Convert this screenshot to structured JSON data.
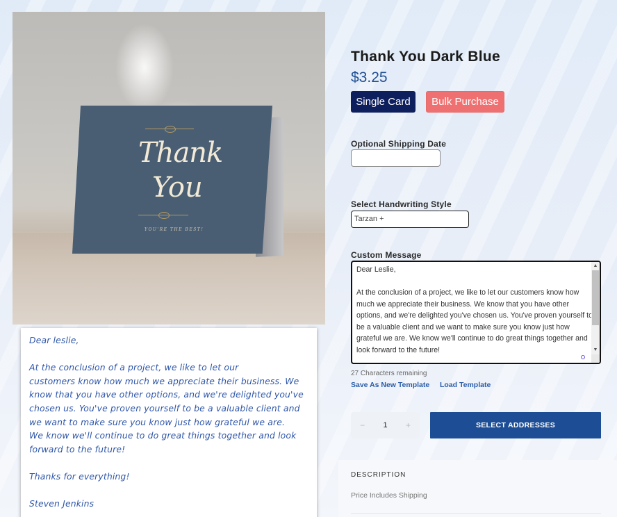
{
  "product": {
    "title": "Thank You Dark Blue",
    "price": "$3.25",
    "image": {
      "card_headline_line1": "Thank",
      "card_headline_line2": "You",
      "card_tagline": "YOU'RE THE BEST!"
    }
  },
  "purchase_type": {
    "options": [
      {
        "label": "Single Card",
        "selected": true,
        "color": "#0d1f5c"
      },
      {
        "label": "Bulk Purchase",
        "selected": false,
        "color": "#ef7070"
      }
    ]
  },
  "form": {
    "shipping_date": {
      "label": "Optional Shipping Date",
      "value": ""
    },
    "handwriting_style": {
      "label": "Select Handwriting Style",
      "value": "Tarzan +"
    },
    "custom_message": {
      "label": "Custom Message",
      "value": "Dear Leslie,\n\nAt the conclusion of a project, we like to let our customers know how much we appreciate their business. We know that you have other options, and we're delighted you've chosen us. You've proven yourself to be a valuable client and we want to make sure you know just how grateful we are. We know we'll continue to do great things together and look forward to the future!",
      "chars_remaining": "27 Characters remaining"
    },
    "links": {
      "save_template": "Save As New Template",
      "load_template": "Load Template"
    },
    "quantity": {
      "minus": "−",
      "value": "1",
      "plus": "+"
    },
    "select_addresses": "SELECT ADDRESSES"
  },
  "preview": {
    "greeting": "Dear leslie,",
    "body": [
      "At the conclusion of a project, we like to let our",
      "customers know how much we appreciate their business. We",
      "know that you have other options, and we're delighted you've",
      "chosen us. You've proven yourself to be a valuable client and",
      "we want to make sure you know just how grateful we are.",
      "We know we'll continue to do great things together and look",
      "forward to the future!"
    ],
    "closing": "Thanks for everything!",
    "signature": "Steven Jenkins"
  },
  "description": {
    "heading": "DESCRIPTION",
    "text": "Price Includes Shipping"
  },
  "colors": {
    "accent_blue": "#1d4e95",
    "navy": "#0d1f5c",
    "coral": "#ef7070",
    "handwriting_ink": "#2e56a8"
  }
}
